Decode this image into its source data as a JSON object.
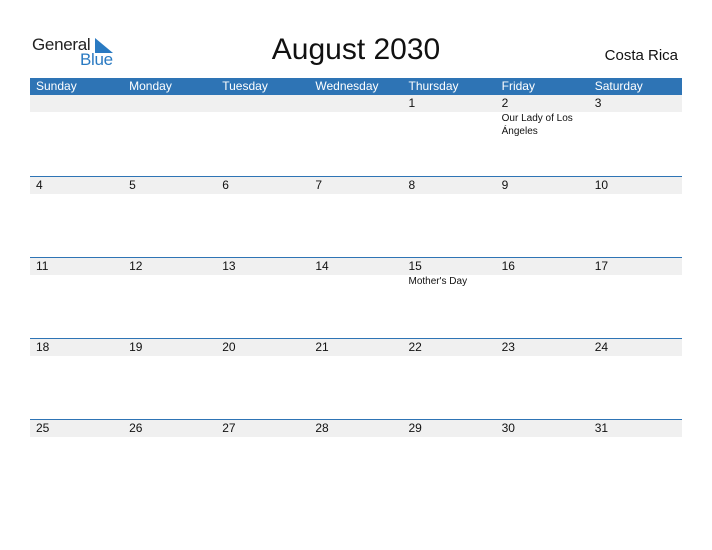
{
  "logo": {
    "part1": "General",
    "part2": "Blue"
  },
  "title": "August 2030",
  "country": "Costa Rica",
  "colors": {
    "accent": "#2e74b5",
    "band": "#f0f0f0"
  },
  "weekdays": [
    "Sunday",
    "Monday",
    "Tuesday",
    "Wednesday",
    "Thursday",
    "Friday",
    "Saturday"
  ],
  "weeks": [
    {
      "days": [
        "",
        "",
        "",
        "",
        "1",
        "2",
        "3"
      ],
      "events": [
        "",
        "",
        "",
        "",
        "",
        "Our Lady of Los Ángeles",
        ""
      ]
    },
    {
      "days": [
        "4",
        "5",
        "6",
        "7",
        "8",
        "9",
        "10"
      ],
      "events": [
        "",
        "",
        "",
        "",
        "",
        "",
        ""
      ]
    },
    {
      "days": [
        "11",
        "12",
        "13",
        "14",
        "15",
        "16",
        "17"
      ],
      "events": [
        "",
        "",
        "",
        "",
        "Mother's Day",
        "",
        ""
      ]
    },
    {
      "days": [
        "18",
        "19",
        "20",
        "21",
        "22",
        "23",
        "24"
      ],
      "events": [
        "",
        "",
        "",
        "",
        "",
        "",
        ""
      ]
    },
    {
      "days": [
        "25",
        "26",
        "27",
        "28",
        "29",
        "30",
        "31"
      ],
      "events": [
        "",
        "",
        "",
        "",
        "",
        "",
        ""
      ]
    }
  ]
}
